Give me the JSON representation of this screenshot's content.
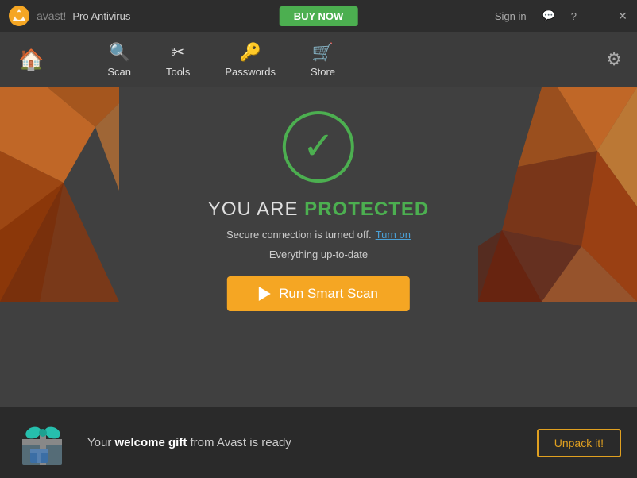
{
  "titleBar": {
    "appName": "Pro Antivirus",
    "buyNowLabel": "BUY NOW",
    "signInLabel": "Sign in",
    "minimizeLabel": "—",
    "closeLabel": "✕"
  },
  "nav": {
    "homeLabel": "🏠",
    "items": [
      {
        "id": "scan",
        "label": "Scan",
        "icon": "🔍"
      },
      {
        "id": "tools",
        "label": "Tools",
        "icon": "✂"
      },
      {
        "id": "passwords",
        "label": "Passwords",
        "icon": "🔑"
      },
      {
        "id": "store",
        "label": "Store",
        "icon": "🛒"
      }
    ],
    "settingsIcon": "⚙"
  },
  "main": {
    "statusText": "YOU ARE",
    "statusHighlight": "PROTECTED",
    "secureConnectionText": "Secure connection is turned off.",
    "turnOnLabel": "Turn on",
    "upToDateText": "Everything up-to-date",
    "runScanLabel": "Run Smart Scan"
  },
  "bottomBar": {
    "giftMessage": "Your ",
    "giftBold": "welcome gift",
    "giftSuffix": " from Avast is ready",
    "unpackLabel": "Unpack it!"
  },
  "colors": {
    "green": "#4caf50",
    "orange": "#f5a623",
    "buyNowGreen": "#4caf50",
    "linkBlue": "#4a9fd5",
    "goldBorder": "#e0a020"
  }
}
